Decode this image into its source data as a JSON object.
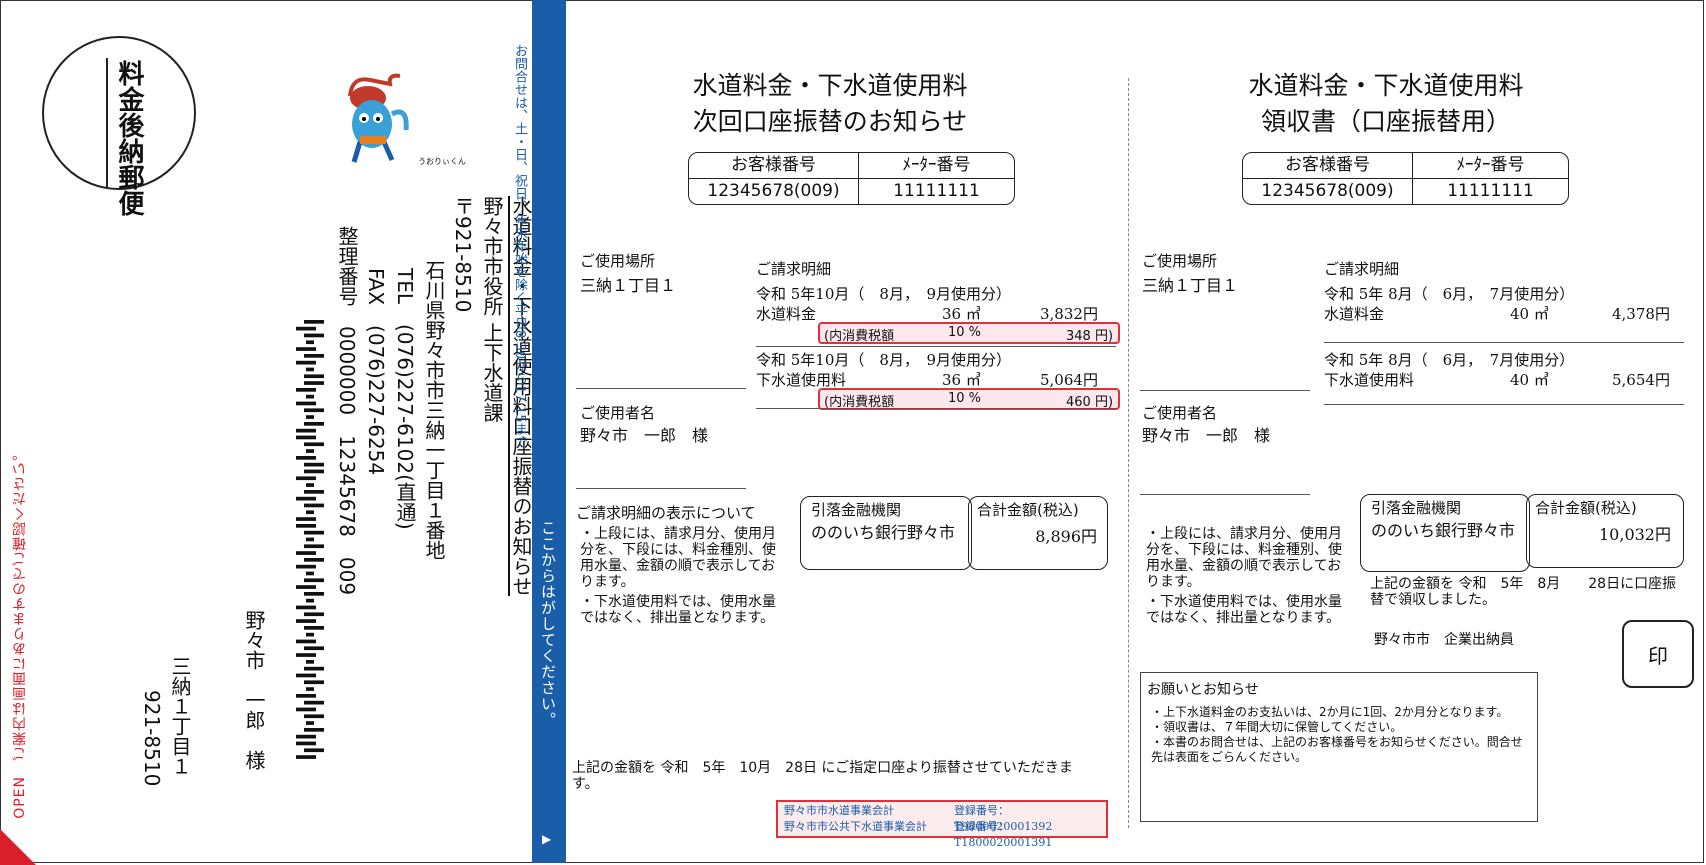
{
  "envelope": {
    "open_label": "OPEN",
    "open_note": "ご案内は画面にありますのでご確認ください。",
    "postage_stamp": "料金後納郵便",
    "recipient_postal": "921-8510",
    "recipient_address": "三納１丁目１",
    "recipient_name": "野々市　一郎　様",
    "sender_lines": [
      "水道料金・下水道使用料口座振替のお知らせ",
      "野々市市役所 上下水道課",
      "〒921-8510",
      "石川県野々市市三納一丁目１番地",
      "TEL　(076)227-6102(直通)",
      "FAX　(076)227-6254",
      "整理番号　0000000　12345678　009"
    ],
    "inquiry": "お問合せは、土・日、祝日、年末年始を除く平日8:30から17:15まで",
    "tear_strip": "ここからはがしてください。",
    "tear_arrow": "▶",
    "mascot_name": "うおりぃくん"
  },
  "notice": {
    "title_line1": "水道料金・下水道使用料",
    "title_line2": "次回口座振替のお知らせ",
    "customer_no_label": "お客様番号",
    "meter_no_label": "ﾒｰﾀｰ番号",
    "customer_no": "12345678(009)",
    "meter_no": "11111111",
    "place_label": "ご使用場所",
    "place": "三納１丁目１",
    "user_label": "ご使用者名",
    "user": "野々市　一郎　様",
    "detail_label": "ご請求明細",
    "water_period": "令和 5年10月（　8月，　9月使用分）",
    "water_name": "水道料金",
    "water_volume": "36 ㎥",
    "water_amount": "3,832円",
    "water_tax_label": "(内消費税額",
    "water_tax_rate": "10 %",
    "water_tax": "348 円)",
    "sewer_period": "令和 5年10月（　8月，　9月使用分）",
    "sewer_name": "下水道使用料",
    "sewer_volume": "36 ㎥",
    "sewer_amount": "5,064円",
    "sewer_tax_label": "(内消費税額",
    "sewer_tax_rate": "10 %",
    "sewer_tax": "460 円)",
    "display_heading": "ご請求明細の表示について",
    "display_notes": [
      "・上段には、請求月分、使用月分を、下段には、料金種別、使用水量、金額の順で表示しております。",
      "・下水道使用料では、使用水量ではなく、排出量となります。"
    ],
    "bank_label": "引落金融機関",
    "bank_name": "ののいち銀行野々市",
    "total_label": "合計金額(税込)",
    "total": "8,896円",
    "transfer_note": "上記の金額を 令和　5年　10月　28日 にご指定口座より振替させていただきます。",
    "reg1_name": "野々市市水道事業会計",
    "reg1_no": "登録番号：T9800020001392",
    "reg2_name": "野々市市公共下水道事業会計",
    "reg2_no": "登録番号：T1800020001391"
  },
  "receipt": {
    "title_line1": "水道料金・下水道使用料",
    "title_line2": "領収書（口座振替用）",
    "customer_no_label": "お客様番号",
    "meter_no_label": "ﾒｰﾀｰ番号",
    "customer_no": "12345678(009)",
    "meter_no": "11111111",
    "place_label": "ご使用場所",
    "place": "三納１丁目１",
    "user_label": "ご使用者名",
    "user": "野々市　一郎　様",
    "detail_label": "ご請求明細",
    "water_period": "令和 5年 8月（　6月，　7月使用分）",
    "water_name": "水道料金",
    "water_volume": "40 ㎥",
    "water_amount": "4,378円",
    "sewer_period": "令和 5年 8月（　6月，　7月使用分）",
    "sewer_name": "下水道使用料",
    "sewer_volume": "40 ㎥",
    "sewer_amount": "5,654円",
    "display_notes": [
      "・上段には、請求月分、使用月分を、下段には、料金種別、使用水量、金額の順で表示しております。",
      "・下水道使用料では、使用水量ではなく、排出量となります。"
    ],
    "bank_label": "引落金融機関",
    "bank_name": "ののいち銀行野々市",
    "total_label": "合計金額(税込)",
    "total": "10,032円",
    "received_note": "上記の金額を 令和　5年　8月　　28日に口座振替で領収しました。",
    "treasurer": "野々市市　企業出納員",
    "seal": "印",
    "notice_heading": "お願いとお知らせ",
    "notice_items": [
      "・上下水道料金のお支払いは、2か月に1回、2か月分となります。",
      "・領収書は、７年間大切に保管してください。",
      "・本書のお問合せは、上記のお客様番号をお知らせください。問合せ先は表面をごらんください。"
    ]
  },
  "colors": {
    "accent_red": "#d8202a",
    "band_blue": "#1a5da8"
  }
}
